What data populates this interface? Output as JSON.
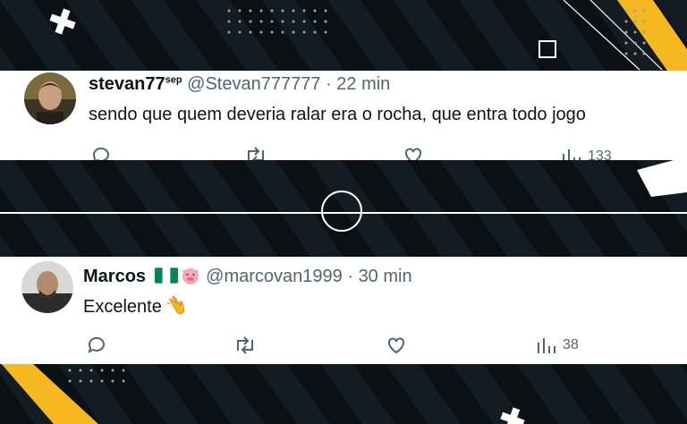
{
  "tweets": [
    {
      "display_name": "stevan77",
      "name_suffix": "sep",
      "handle": "@Stevan777777",
      "time": "22 min",
      "text": "sendo que quem deveria ralar era o rocha, que entra todo jogo",
      "views": "133"
    },
    {
      "display_name": "Marcos",
      "handle": "@marcovan1999",
      "time": "30 min",
      "text": "Excelente",
      "views": "38"
    }
  ],
  "colors": {
    "accent_yellow": "#f5b820",
    "background": "#0b1014",
    "meta_gray": "#536471"
  }
}
